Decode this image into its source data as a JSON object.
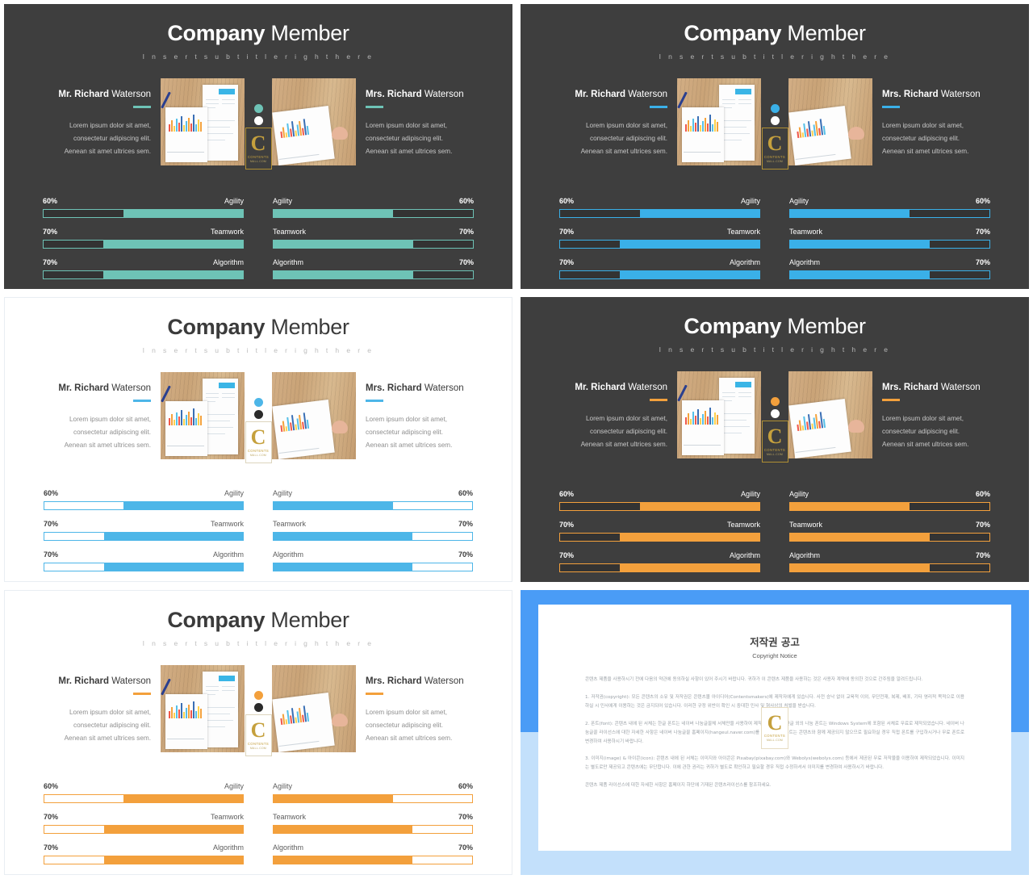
{
  "deck": {
    "title_bold": "Company",
    "title_normal": " Member",
    "subtitle": "I n s e r t   s u b t i t l e   r i g h t   h e r e",
    "member_left": {
      "bold": "Mr. Richard",
      "normal": " Waterson"
    },
    "member_right": {
      "bold": "Mrs. Richard",
      "normal": " Waterson"
    },
    "bio_lines": [
      "Lorem ipsum dolor sit amet,",
      "consectetur adipiscing elit.",
      "Aenean sit amet ultrices sem."
    ],
    "badge": {
      "letter": "C",
      "line1": "CONTENTS",
      "line2": "MALL.COM"
    }
  },
  "skills": [
    {
      "label": "Agility",
      "percent": "60%",
      "value": 60
    },
    {
      "label": "Teamwork",
      "percent": "70%",
      "value": 70
    },
    {
      "label": "Algorithm",
      "percent": "70%",
      "value": 70
    }
  ],
  "colors": {
    "teal": "#6ec3b6",
    "blue": "#4db6e8",
    "orange": "#f3a03c",
    "dark_bg": "#3e3e3e",
    "light_bg": "#ffffff",
    "dark_track": "#333333",
    "light_track": "#ffffff",
    "copy_band_dark": "#4a9cf6",
    "copy_band_light": "#c3e0fb"
  },
  "slides": [
    {
      "id": "slide-1",
      "theme": "dark",
      "accent_name": "teal",
      "accent": "#6ec3b6",
      "dot": "#6ec3b6"
    },
    {
      "id": "slide-2",
      "theme": "dark",
      "accent_name": "blue",
      "accent": "#3ab0e8",
      "dot": "#3ab0e8"
    },
    {
      "id": "slide-3",
      "theme": "light",
      "accent_name": "blue",
      "accent": "#4db6e8",
      "dot": "#4db6e8"
    },
    {
      "id": "slide-4",
      "theme": "dark",
      "accent_name": "orange",
      "accent": "#f3a03c",
      "dot": "#f3a03c"
    },
    {
      "id": "slide-5",
      "theme": "light",
      "accent_name": "orange",
      "accent": "#f3a03c",
      "dot": "#f3a03c"
    }
  ],
  "copyright": {
    "title": "저작권 공고",
    "subtitle": "Copyright Notice",
    "paragraphs": [
      "콘텐츠 제품을 사용하시기 전에 다음의 약관에 동의하실 사항이 있어 주시기 바랍니다. 귀하가 이 콘텐츠 제품을 사용하는 것은 사용자 계약에 동의한 것으로 간주됨을 알려드립니다.",
      "1. 저작권(copyright): 모든 콘텐츠의 소유 및 저작권은 콘텐츠몰 아이디어(Contentsmakers)에 제작자에게 있습니다. 사전 승낙 없이 교육적 이외, 무단전재, 복제, 배포, 기타 영리적 목적으로 이용하실 시 민사에게 이용하는 것은 금지되어 있습니다. 이러한 규정 위반이 확인 시 중대한 민사 및 형사상의 처벌을 받습니다.",
      "2. 폰트(font): 콘텐츠 내에 된 서체는 한글 폰트는 네이버 나눔글꼴체 서체만을 사용하여 제작되었습니다. 한글 외의 나눔 폰트는 Windows System에 포함된 서체로 무료로 제작되었습니다. 네이버 나눔글꼴 라이선스에 대한 자세한 사항은 네이버 나눔글꼴 홈페이지(hangeul.naver.com)를 참조하세요. 폰트는 콘텐츠와 함께 제공되지 않으므로 필요하실 경우 직접 폰트를 구입하시거나 무료 폰트로 변경하여 사용하시기 바랍니다.",
      "3. 이미지(image) & 아이콘(icon): 콘텐츠 내에 된 서체는 이미지와 아이콘은 Pixabay(pixabay.com)와 Webolys(webolys.com) 등에서 제공된 무료 저작물을 이용하여 제작되었습니다. 이미지는 별도로만 제공되고 콘텐츠에는 무단합니다. 이에 관한 권리는 귀하가 별도로 확인하고 필요할 경우 직접 수정하셔서 이미지를 변경하여 사용하시기 바랍니다.",
      "콘텐츠 제품 라이선스에 대한 자세한 사항은 홈페이지 하단에 기재된 콘텐츠라이선스를 참조하세요."
    ]
  }
}
